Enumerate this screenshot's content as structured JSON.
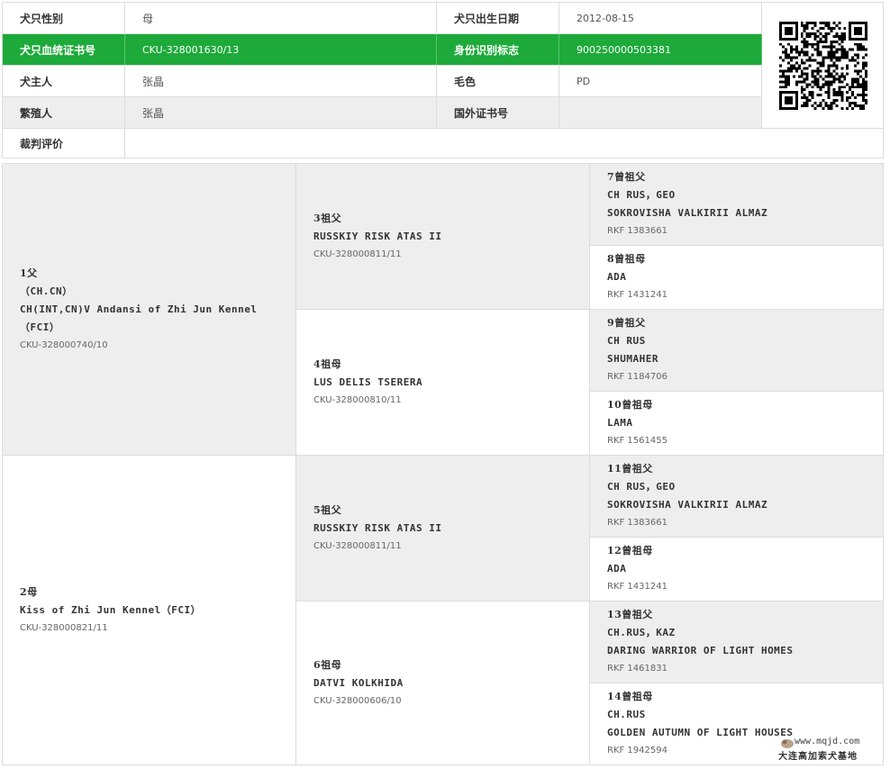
{
  "info": {
    "sex_label": "犬只性别",
    "sex_value": "母",
    "dob_label": "犬只出生日期",
    "dob_value": "2012-08-15",
    "cert_label": "犬只血统证书号",
    "cert_value": "CKU-328001630/13",
    "id_label": "身份识别标志",
    "id_value": "900250000503381",
    "owner_label": "犬主人",
    "owner_value": "张晶",
    "color_label": "毛色",
    "color_value": "PD",
    "breeder_label": "繁殖人",
    "breeder_value": "张晶",
    "foreign_label": "国外证书号",
    "foreign_value": "",
    "judge_label": "裁判评价",
    "judge_value": ""
  },
  "pedigree": {
    "sire": {
      "title": "1父",
      "lines": [
        "（CH.CN）",
        "CH(INT,CN)V Andansi of Zhi Jun Kennel",
        "（FCI）"
      ],
      "reg": "CKU-328000740/10"
    },
    "dam": {
      "title": "2母",
      "lines": [
        "Kiss of Zhi Jun Kennel（FCI）"
      ],
      "reg": "CKU-328000821/11"
    },
    "gp3": {
      "title": "3祖父",
      "name": "RUSSKIY RISK ATAS II",
      "reg": "CKU-328000811/11"
    },
    "gp4": {
      "title": "4祖母",
      "name": "LUS DELIS TSERERA",
      "reg": "CKU-328000810/11"
    },
    "gp5": {
      "title": "5祖父",
      "name": "RUSSKIY RISK ATAS II",
      "reg": "CKU-328000811/11"
    },
    "gp6": {
      "title": "6祖母",
      "name": "DATVI KOLKHIDA",
      "reg": "CKU-328000606/10"
    },
    "g7": {
      "title": "7曾祖父",
      "line1": "CH RUS，GEO",
      "line2": "SOKROVISHA VALKIRII ALMAZ",
      "reg": "RKF 1383661"
    },
    "g8": {
      "title": "8曾祖母",
      "line1": "ADA",
      "reg": "RKF 1431241"
    },
    "g9": {
      "title": "9曾祖父",
      "line1": "CH RUS",
      "line2": "SHUMAHER",
      "reg": "RKF 1184706"
    },
    "g10": {
      "title": "10曾祖母",
      "line1": "LAMA",
      "reg": "RKF 1561455"
    },
    "g11": {
      "title": "11曾祖父",
      "line1": "CH RUS，GEO",
      "line2": "SOKROVISHA VALKIRII ALMAZ",
      "reg": "RKF 1383661"
    },
    "g12": {
      "title": "12曾祖母",
      "line1": "ADA",
      "reg": "RKF 1431241"
    },
    "g13": {
      "title": "13曾祖父",
      "line1": "CH.RUS，KAZ",
      "line2": "DARING WARRIOR OF LIGHT HOMES",
      "reg": "RKF 1461831"
    },
    "g14": {
      "title": "14曾祖母",
      "line1": "CH.RUS",
      "line2": "GOLDEN AUTUMN OF LIGHT HOUSES",
      "reg": "RKF 1942594"
    }
  },
  "watermark": {
    "url": "www.mqjd.com",
    "text": "大连高加索犬基地"
  },
  "colors": {
    "accent": "#1daa3a",
    "row_gray": "#eeeeee",
    "border": "#dcdcdc"
  }
}
